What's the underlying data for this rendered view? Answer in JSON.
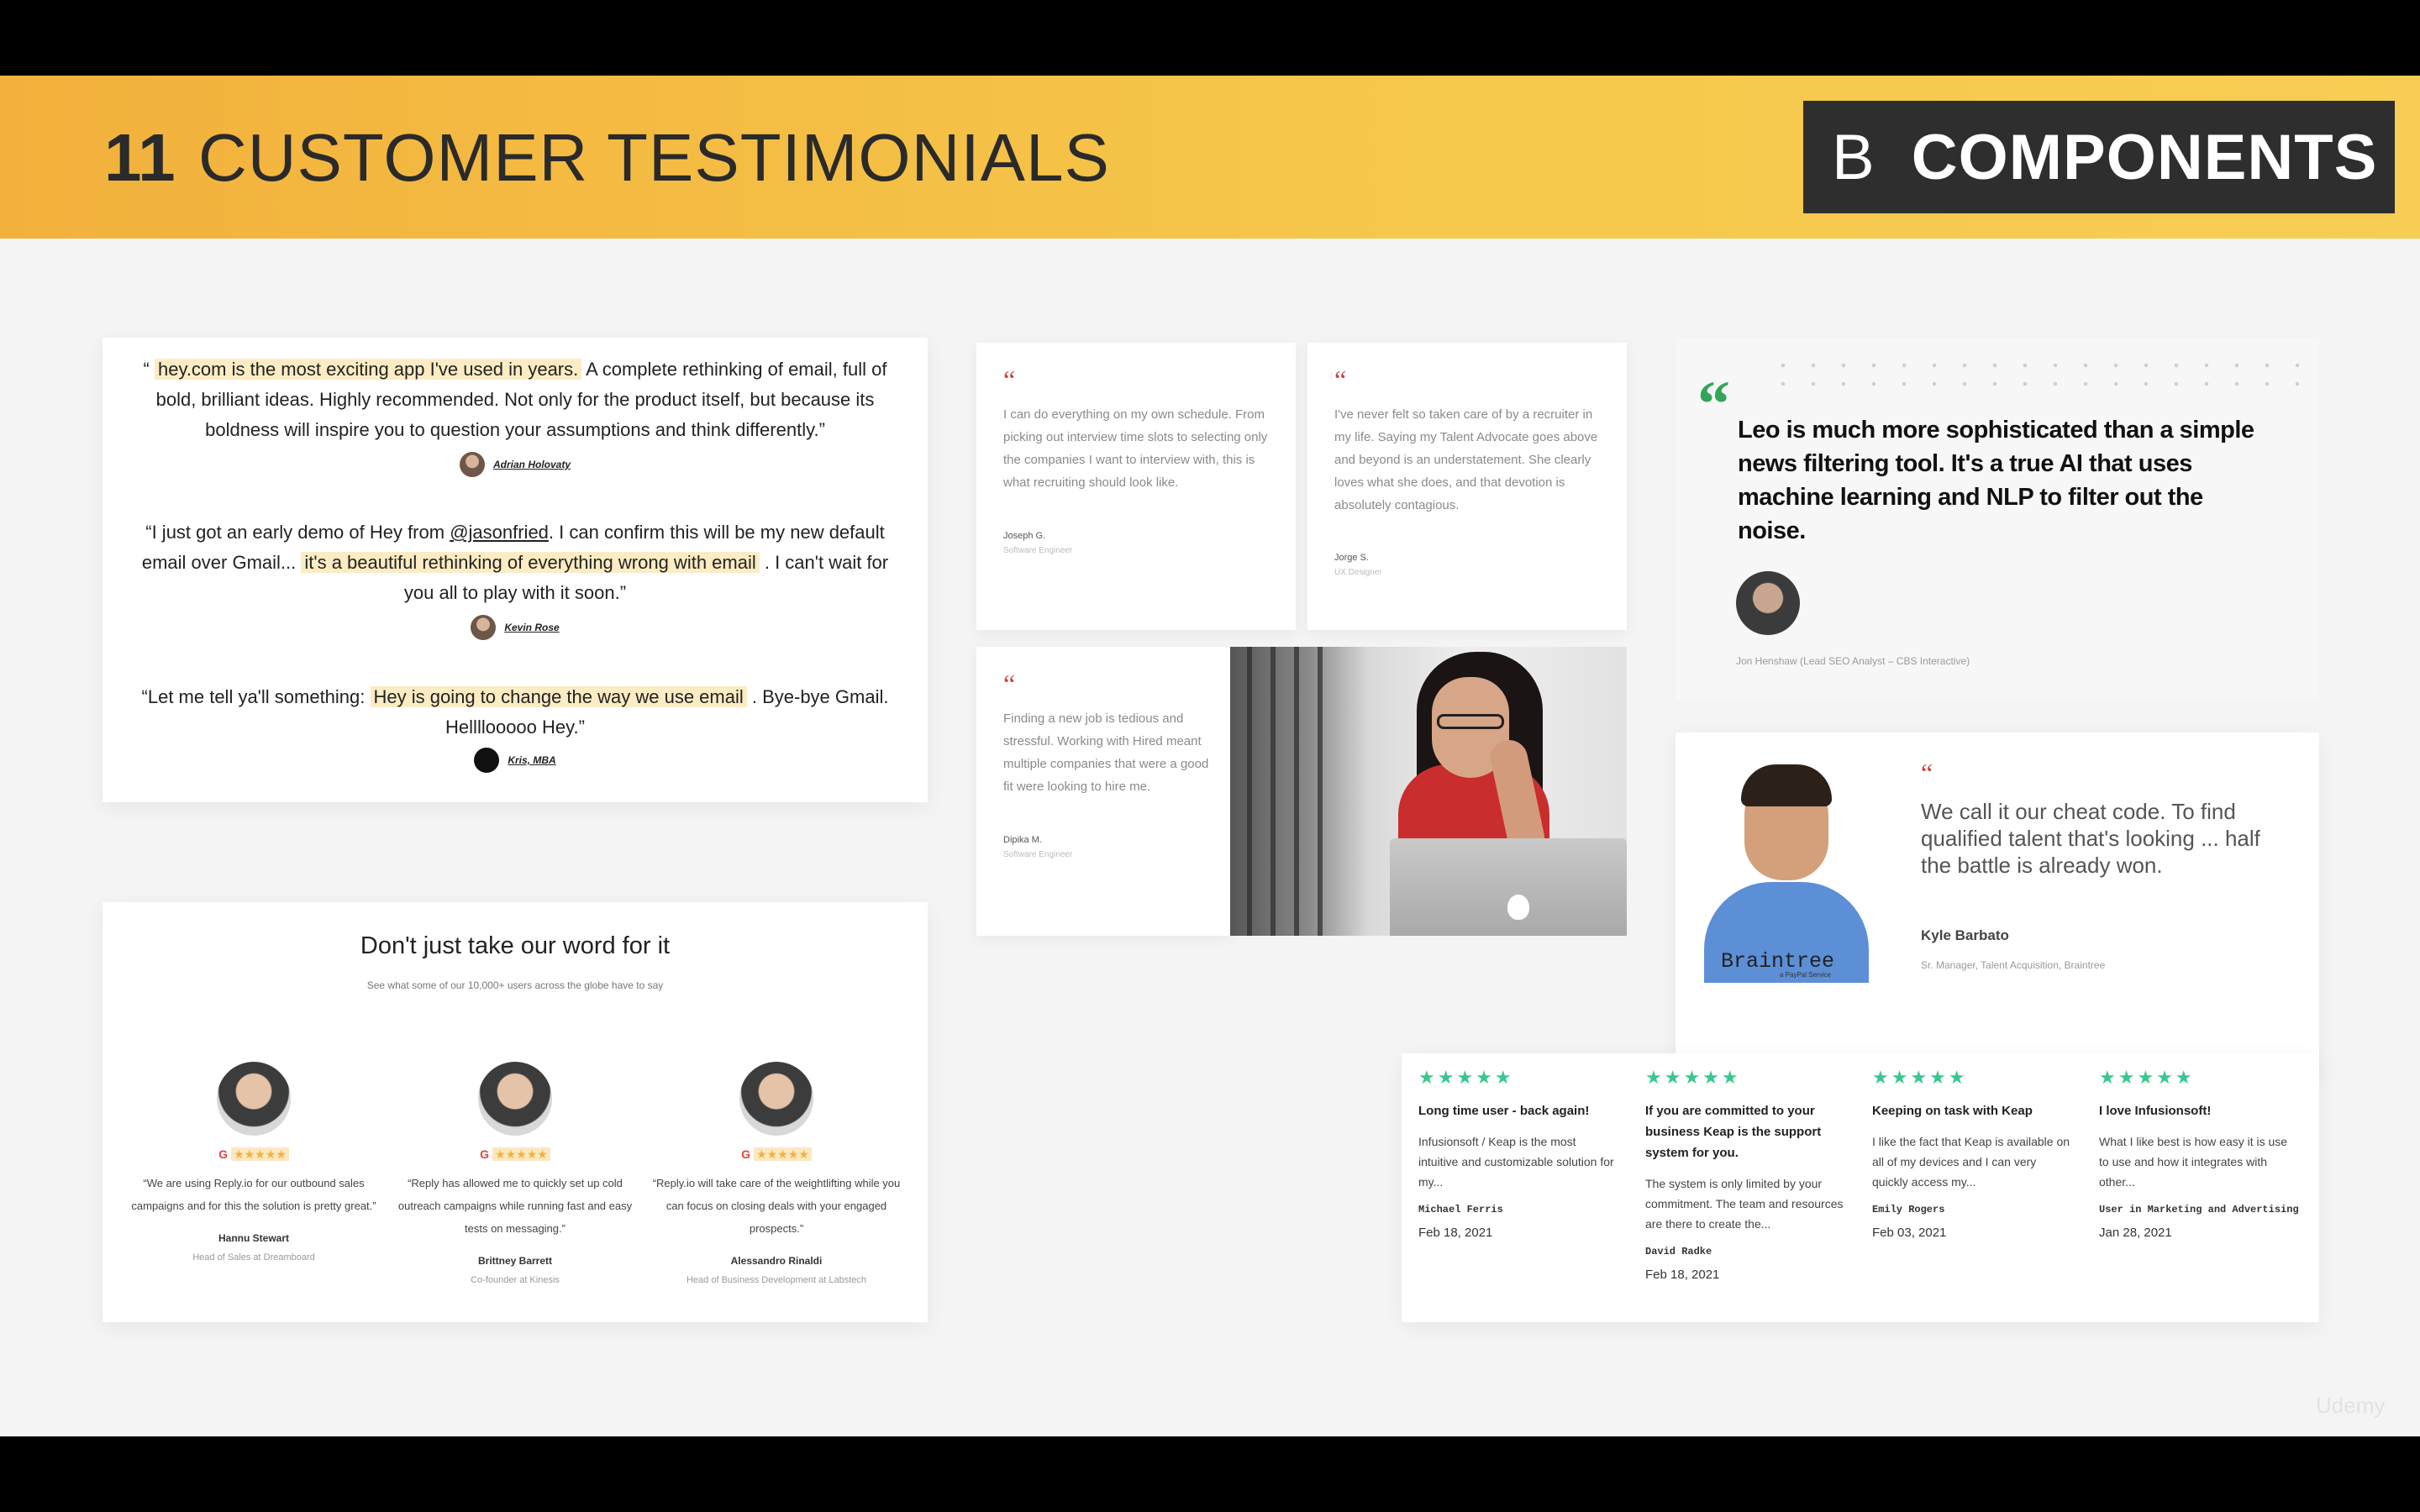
{
  "header": {
    "number": "11",
    "title": "CUSTOMER TESTIMONIALS",
    "badge_letter": "B",
    "badge_text": "COMPONENTS"
  },
  "hey": {
    "q1": {
      "open": "“ ",
      "hl": "hey.com is the most exciting app I've used in years.",
      "rest": " A complete rethinking of email, full of bold, brilliant ideas. Highly recommended. Not only for the product itself, but because its boldness will inspire you to question your assumptions and think differently.”",
      "author": "Adrian Holovaty"
    },
    "q2": {
      "pre": "“I just got an early demo of Hey from ",
      "link": "@jasonfried",
      "mid": ". I can confirm this will be my new default email over Gmail... ",
      "hl": "it's a beautiful rethinking of everything wrong with email",
      "rest": " . I can't wait for you all to play with it soon.”",
      "author": "Kevin Rose"
    },
    "q3": {
      "pre": "“Let me tell ya'll something: ",
      "hl": "Hey is going to change the way we use email",
      "rest": " . Bye-bye Gmail. Hellllooooo Hey.”",
      "author": "Kris, MBA"
    }
  },
  "reply": {
    "title": "Don't just take our word for it",
    "subtitle": "See what some of our 10,000+ users across the globe have to say",
    "g": "G",
    "stars": "★★★★★",
    "items": [
      {
        "text": "“We are using Reply.io for our outbound sales campaigns and for this the solution is pretty great.”",
        "name": "Hannu Stewart",
        "role": "Head of Sales at Dreamboard"
      },
      {
        "text": "“Reply has allowed me to quickly set up cold outreach campaigns while running fast and easy tests on messaging.”",
        "name": "Brittney Barrett",
        "role": "Co-founder at Kinesis"
      },
      {
        "text": "“Reply.io will take care of the weightlifting while you can focus on closing deals with your engaged prospects.”",
        "name": "Alessandro Rinaldi",
        "role": "Head of Business Development at Labstech"
      }
    ]
  },
  "hired": {
    "quote_mark": "“",
    "items": [
      {
        "text": "I can do everything on my own schedule. From picking out interview time slots to selecting only the companies I want to interview with, this is what recruiting should look like.",
        "name": "Joseph G.",
        "role": "Software Engineer"
      },
      {
        "text": "I've never felt so taken care of by a recruiter in my life. Saying my Talent Advocate goes above and beyond is an understatement. She clearly loves what she does, and that devotion is absolutely contagious.",
        "name": "Jorge S.",
        "role": "UX Designer"
      },
      {
        "text": "Finding a new job is tedious and stressful. Working with Hired meant multiple companies that were a good fit were looking to hire me.",
        "name": "Dipika M.",
        "role": "Software Engineer"
      }
    ]
  },
  "leo": {
    "quote_mark": "“",
    "text": "Leo is much more sophisticated than a simple news filtering tool. It's a true AI that uses machine learning and NLP to filter out the noise.",
    "cite": "Jon Henshaw (Lead SEO Analyst – CBS Interactive)"
  },
  "braintree": {
    "logo": "Braintree",
    "logo_sub": "a PayPal Service",
    "quote_mark": "“",
    "text": "We call it our cheat code. To find qualified talent that's looking ... half the battle is already won.",
    "name": "Kyle Barbato",
    "role": "Sr. Manager, Talent Acquisition, Braintree"
  },
  "keap": {
    "stars": "★★★★★",
    "items": [
      {
        "title": "Long time user - back again!",
        "text": "Infusionsoft / Keap is the most intuitive and customizable solution for my...",
        "name": "Michael Ferris",
        "date": "Feb 18, 2021"
      },
      {
        "title": "If you are committed to your business Keap is the support system for you.",
        "text": "The system is only limited by your commitment. The team and resources are there to create the...",
        "name": "David Radke",
        "date": "Feb 18, 2021"
      },
      {
        "title": "Keeping on task with Keap",
        "text": "I like the fact that Keap is available on all of my devices and I can very quickly access my...",
        "name": "Emily Rogers",
        "date": "Feb 03, 2021"
      },
      {
        "title": "I love Infusionsoft!",
        "text": "What I like best is how easy it is use to use and how it integrates with other...",
        "name": "User in Marketing and Advertising",
        "date": "Jan 28, 2021"
      }
    ]
  },
  "watermark": "Udemy"
}
